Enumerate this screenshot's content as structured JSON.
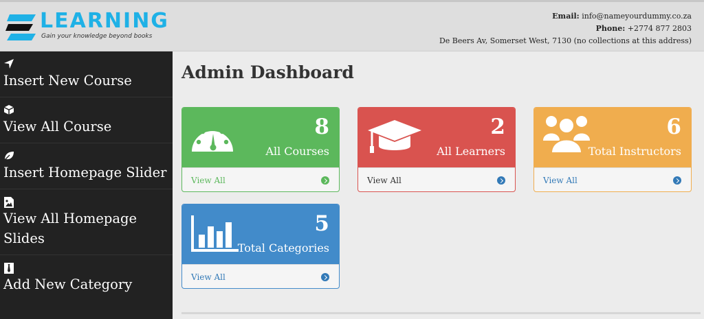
{
  "header": {
    "logo_word": "LEARNING",
    "logo_tagline": "Gain your knowledge beyond books",
    "email_label": "Email:",
    "email": "info@nameyourdummy.co.za",
    "phone_label": "Phone:",
    "phone": "+2774 877 2803",
    "address": "De Beers Av, Somerset West, 7130 (no collections at this address)"
  },
  "sidebar": {
    "items": [
      {
        "icon": "location-arrow-icon",
        "label": "Insert New Course"
      },
      {
        "icon": "cube-icon",
        "label": "View All Course"
      },
      {
        "icon": "leaf-icon",
        "label": "Insert Homepage Slider"
      },
      {
        "icon": "image-file-icon",
        "label": "View All Homepage Slides"
      },
      {
        "icon": "tie-icon",
        "label": "Add New Category"
      }
    ]
  },
  "main": {
    "title": "Admin Dashboard",
    "cards": [
      {
        "count": "8",
        "label": "All Courses",
        "link": "View All",
        "icon": "dashboard-gauge-icon",
        "color": "#5cb85c"
      },
      {
        "count": "2",
        "label": "All Learners",
        "link": "View All",
        "icon": "graduation-cap-icon",
        "color": "#d9534f"
      },
      {
        "count": "6",
        "label": "Total Instructors",
        "link": "View All",
        "icon": "users-group-icon",
        "color": "#f0ad4e"
      },
      {
        "count": "5",
        "label": "Total Categories",
        "link": "View All",
        "icon": "bar-chart-icon",
        "color": "#428bca"
      }
    ]
  }
}
